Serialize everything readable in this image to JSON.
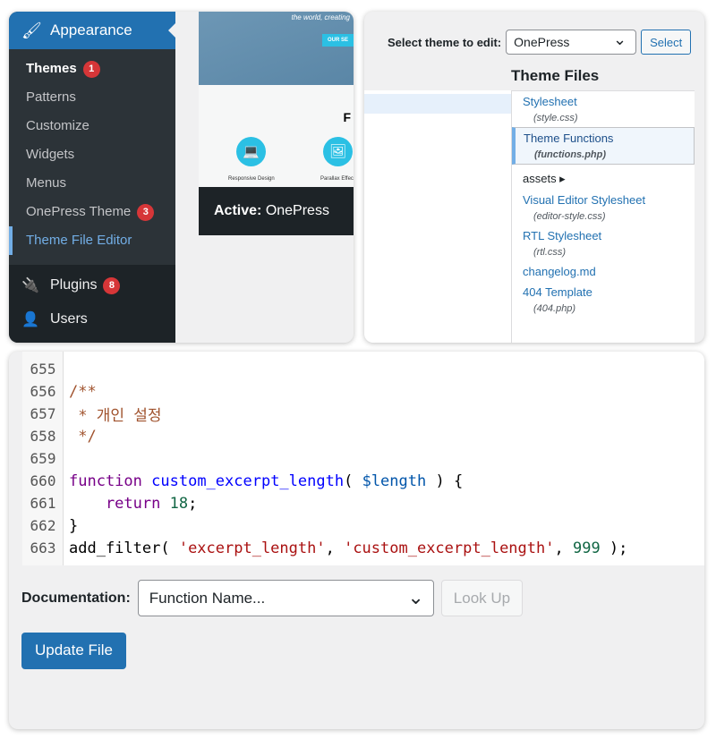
{
  "sidebar": {
    "appearance": "Appearance",
    "items": [
      {
        "label": "Themes",
        "badge": "1"
      },
      {
        "label": "Patterns"
      },
      {
        "label": "Customize"
      },
      {
        "label": "Widgets"
      },
      {
        "label": "Menus"
      },
      {
        "label": "OnePress Theme",
        "badge": "3"
      },
      {
        "label": "Theme File Editor"
      }
    ],
    "plugins": "Plugins",
    "plugins_badge": "8",
    "users": "Users"
  },
  "preview": {
    "tagline": "the world, creating",
    "hero_button": "OUR SE",
    "features_heading": "F",
    "feature1": "Responsive Design",
    "feature2": "Parallax Effec",
    "active_label": "Active:",
    "active_theme": "OnePress"
  },
  "editor": {
    "select_label": "Select theme to edit:",
    "selected_theme": "OnePress",
    "select_button": "Select",
    "files_heading": "Theme Files",
    "files": [
      {
        "name": "Stylesheet",
        "file": "(style.css)"
      },
      {
        "name": "Theme Functions",
        "file": "(functions.php)"
      },
      {
        "name": "assets ▸"
      },
      {
        "name": "Visual Editor Stylesheet",
        "file": "(editor-style.css)"
      },
      {
        "name": "RTL Stylesheet",
        "file": "(rtl.css)"
      },
      {
        "name": "changelog.md"
      },
      {
        "name": "404 Template",
        "file": "(404.php)"
      }
    ]
  },
  "code": {
    "lines": [
      "655",
      "656",
      "657",
      "658",
      "659",
      "660",
      "661",
      "662",
      "663"
    ],
    "t656": "/**",
    "t657": " * 개인 설정",
    "t658": " */",
    "t660a": "function",
    "t660b": "custom_excerpt_length",
    "t660c": "(",
    "t660d": "$length",
    "t660e": ") {",
    "t661a": "    return",
    "t661b": "18",
    ";": ";",
    "t662": "}",
    "t663a": "add_filter( ",
    "t663b": "'excerpt_length'",
    "t663c": ", ",
    "t663d": "'custom_excerpt_length'",
    "t663e": "999",
    "t663f": " );"
  },
  "documentation": {
    "label": "Documentation:",
    "select_value": "Function Name...",
    "lookup": "Look Up"
  },
  "update_button": "Update File"
}
